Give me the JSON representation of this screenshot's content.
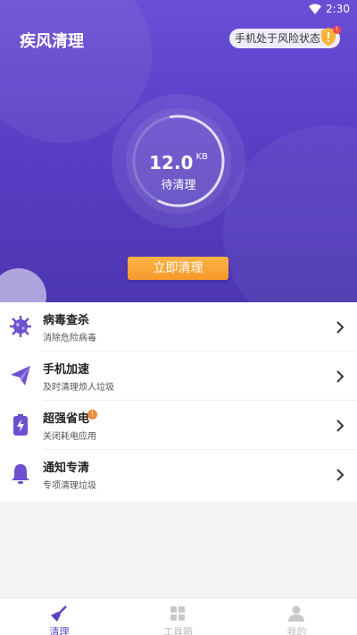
{
  "status_bar": {
    "time": "2:30"
  },
  "header": {
    "title": "疾风清理",
    "risk_text": "手机处于风险状态",
    "risk_badge": "!"
  },
  "scan": {
    "size_value": "12.0",
    "size_unit": "KB",
    "label": "待清理",
    "progress_fraction": 0.6
  },
  "clean_button": {
    "label": "立即清理"
  },
  "features": [
    {
      "title": "病毒查杀",
      "subtitle": "消除危险病毒",
      "icon": "virus-icon"
    },
    {
      "title": "手机加速",
      "subtitle": "及时清理烦人垃圾",
      "icon": "paper-plane-icon"
    },
    {
      "title": "超强省电",
      "subtitle": "关闭耗电应用",
      "icon": "battery-icon",
      "badge": "!"
    },
    {
      "title": "通知专清",
      "subtitle": "专项清理垃圾",
      "icon": "bell-icon"
    }
  ],
  "tabs": [
    {
      "label": "清理",
      "icon": "broom-icon",
      "active": true
    },
    {
      "label": "工具箱",
      "icon": "grid-icon",
      "active": false
    },
    {
      "label": "我的",
      "icon": "user-icon",
      "active": false
    }
  ],
  "colors": {
    "primary": "#5b3fbf",
    "accent": "#f59a2a"
  }
}
